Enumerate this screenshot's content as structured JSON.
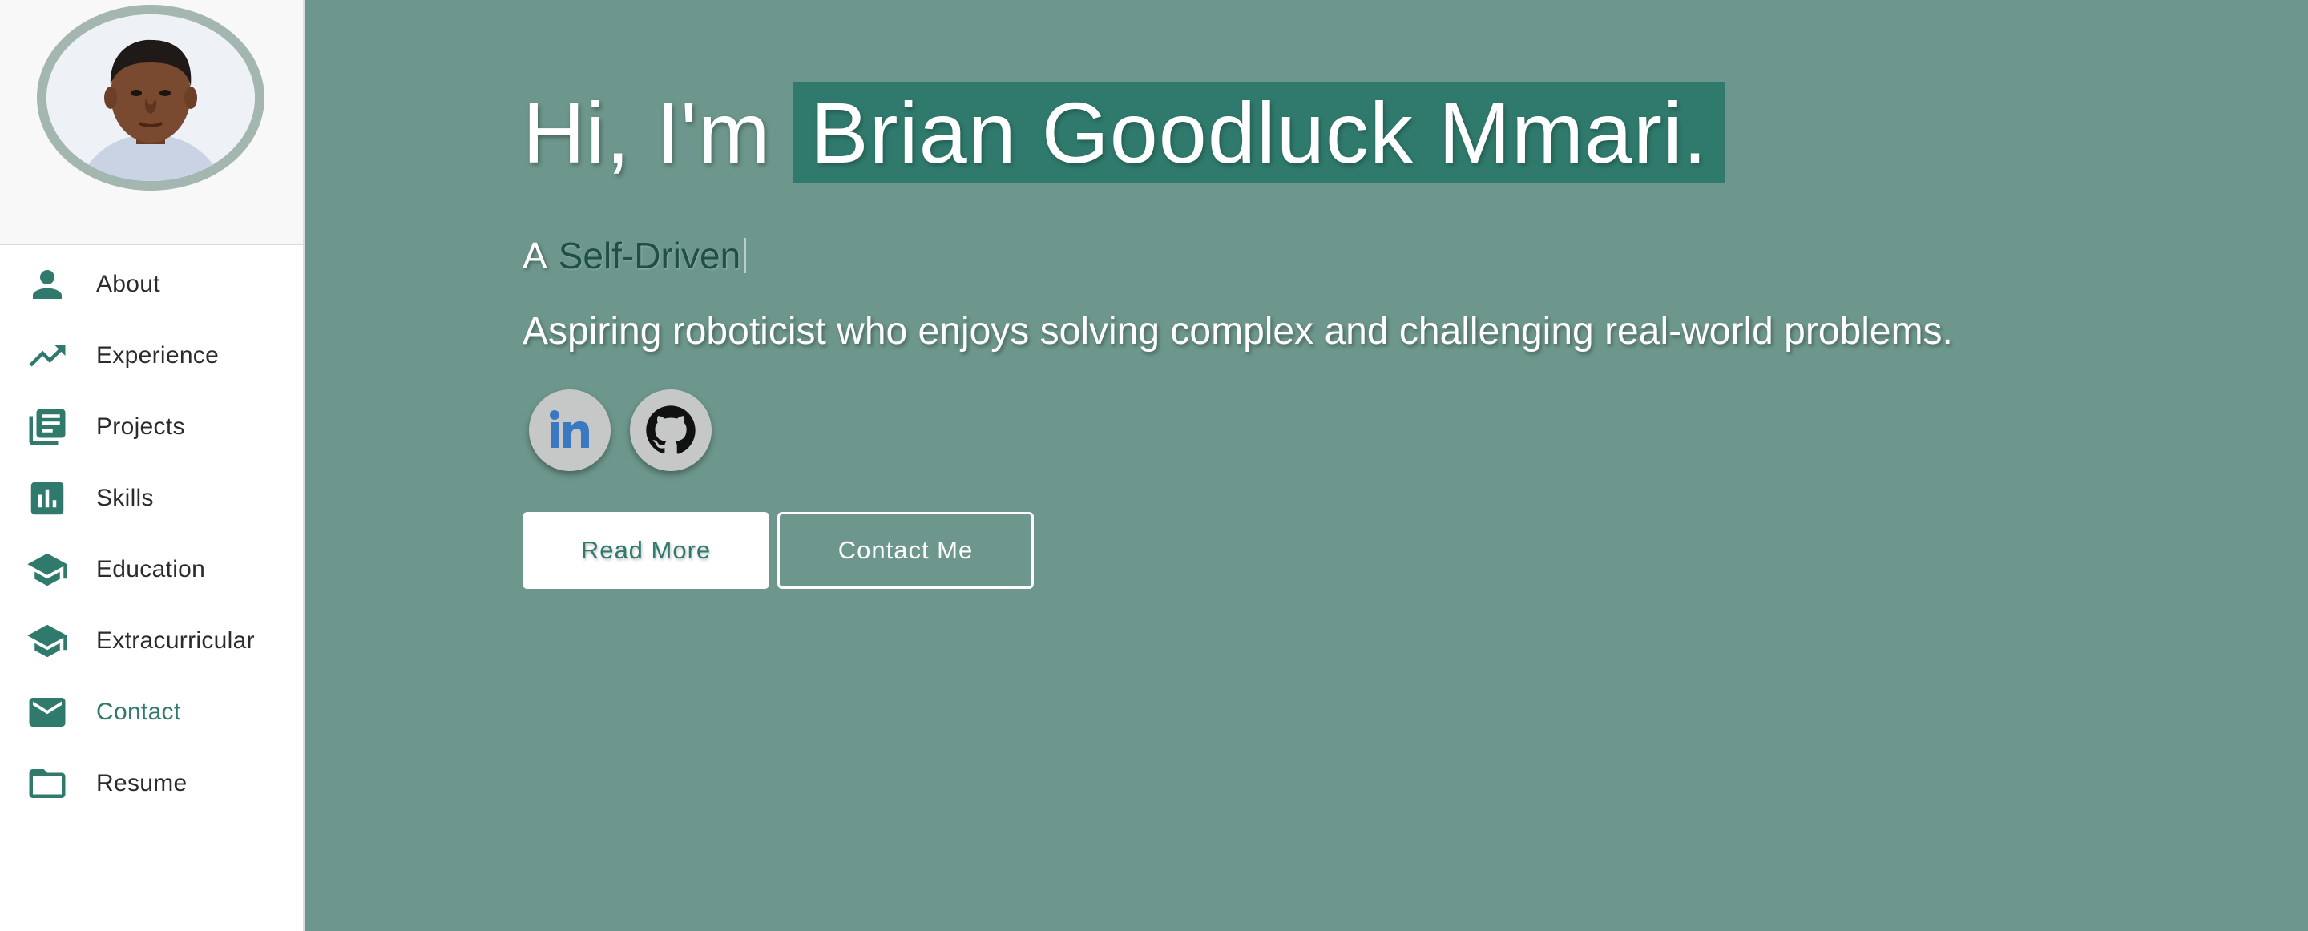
{
  "sidebar": {
    "avatar_alt": "Profile photo",
    "items": [
      {
        "label": "About",
        "icon": "person-icon"
      },
      {
        "label": "Experience",
        "icon": "trending-up-icon"
      },
      {
        "label": "Projects",
        "icon": "library-books-icon"
      },
      {
        "label": "Skills",
        "icon": "bar-chart-icon"
      },
      {
        "label": "Education",
        "icon": "school-icon"
      },
      {
        "label": "Extracurricular",
        "icon": "school-icon"
      },
      {
        "label": "Contact",
        "icon": "mail-icon",
        "active": true
      },
      {
        "label": "Resume",
        "icon": "folder-icon"
      }
    ]
  },
  "hero": {
    "greeting_prefix": "Hi, I'm",
    "name": "Brian Goodluck Mmari.",
    "typing_prefix": "A",
    "typing_word": "Self-Driven",
    "tagline": "Aspiring roboticist who enjoys solving complex and challenging real-world problems.",
    "socials": [
      {
        "name": "LinkedIn",
        "icon": "linkedin-icon"
      },
      {
        "name": "GitHub",
        "icon": "github-icon"
      }
    ],
    "read_more_label": "Read More",
    "contact_label": "Contact Me"
  },
  "colors": {
    "accent": "#2f7a6c",
    "main_bg": "#6d978c",
    "sidebar_bg": "#ffffff",
    "social_bg": "#c6c8c8",
    "linkedin_blue": "#3b78c2"
  }
}
